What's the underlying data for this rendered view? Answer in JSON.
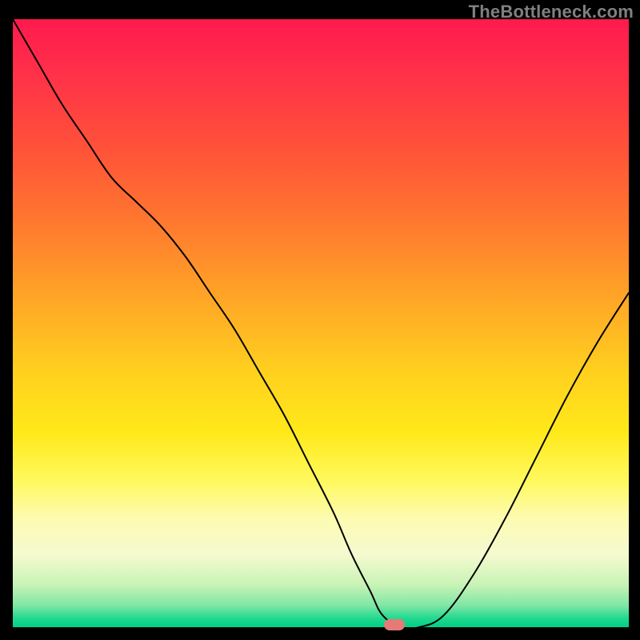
{
  "watermark": "TheBottleneck.com",
  "colors": {
    "gradient_top": "#ff1a4d",
    "gradient_mid": "#ffd01e",
    "gradient_bottom": "#00cf85",
    "curve": "#000000",
    "marker": "#e77a77",
    "background": "#000000"
  },
  "chart_data": {
    "type": "line",
    "title": "",
    "xlabel": "",
    "ylabel": "",
    "xlim": [
      0,
      100
    ],
    "ylim": [
      0,
      100
    ],
    "grid": false,
    "legend": false,
    "series": [
      {
        "name": "bottleneck-curve",
        "x": [
          0,
          4,
          8,
          12,
          16,
          20,
          24,
          28,
          32,
          36,
          40,
          44,
          48,
          52,
          55,
          58,
          60,
          63,
          66,
          70,
          75,
          80,
          85,
          90,
          95,
          100
        ],
        "values": [
          100,
          93,
          86,
          80,
          74,
          70,
          66,
          61,
          55,
          49,
          42,
          35,
          27,
          19,
          12,
          6,
          2,
          0,
          0,
          2,
          9,
          18,
          28,
          38,
          47,
          55
        ]
      }
    ],
    "annotations": [
      {
        "name": "optimal-marker",
        "x": 62,
        "y": 0
      }
    ],
    "notes": "Axes are unlabeled in the source image; x and y are normalized 0-100. Values are estimated from pixel positions."
  }
}
